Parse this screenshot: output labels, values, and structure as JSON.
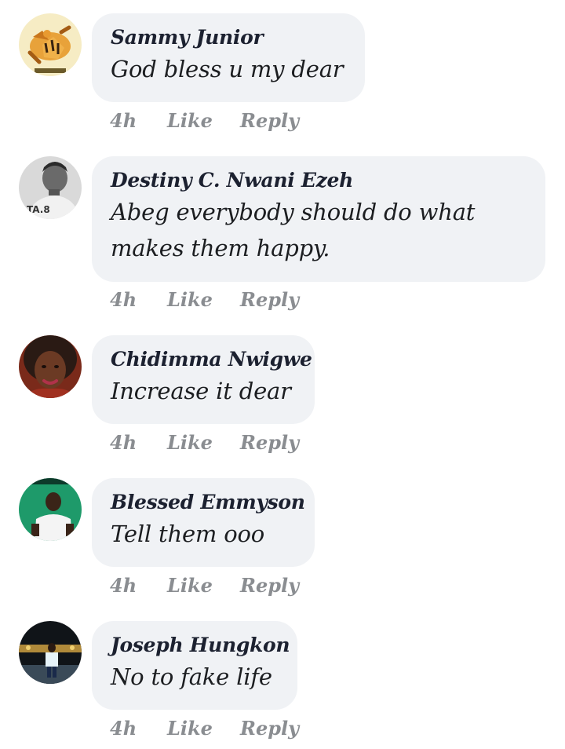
{
  "comments": [
    {
      "author": "Sammy Junior",
      "text": "God bless u my dear",
      "time": "4h",
      "like_label": "Like",
      "reply_label": "Reply",
      "avatar_icon": "tiger-avatar"
    },
    {
      "author": "Destiny C. Nwani Ezeh",
      "text": "Abeg everybody should do what makes them happy.",
      "time": "4h",
      "like_label": "Like",
      "reply_label": "Reply",
      "avatar_icon": "man-bw-avatar"
    },
    {
      "author": "Chidimma Nwigwe",
      "text": "Increase it dear",
      "time": "4h",
      "like_label": "Like",
      "reply_label": "Reply",
      "avatar_icon": "woman-avatar"
    },
    {
      "author": "Blessed Emmyson",
      "text": "Tell them ooo",
      "time": "4h",
      "like_label": "Like",
      "reply_label": "Reply",
      "avatar_icon": "man-green-avatar"
    },
    {
      "author": "Joseph Hungkon",
      "text": "No to fake life",
      "time": "4h",
      "like_label": "Like",
      "reply_label": "Reply",
      "avatar_icon": "man-night-avatar"
    }
  ],
  "colors": {
    "bubble": "#f0f2f5",
    "meta": "#8a8d91",
    "text": "#1c1e21"
  }
}
